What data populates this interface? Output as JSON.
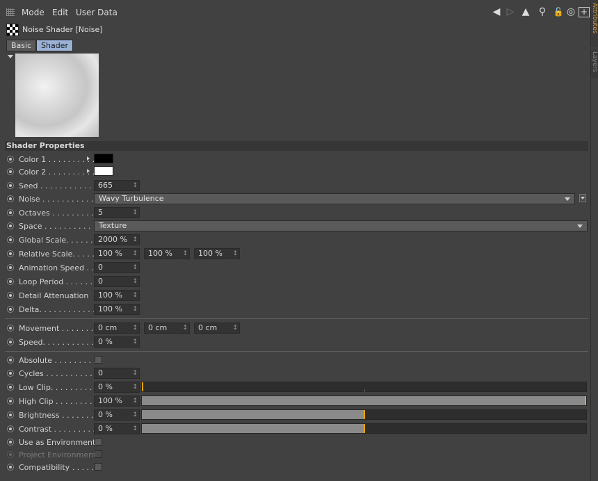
{
  "menu": {
    "grip_icon": "grip-icon",
    "items": [
      "Mode",
      "Edit",
      "User Data"
    ]
  },
  "toolbar": {
    "icons": [
      "back-arrow-icon",
      "forward-arrow-icon",
      "up-arrow-icon",
      "search-icon",
      "lock-icon",
      "target-icon",
      "new-panel-icon"
    ]
  },
  "side_tabs": [
    "Attributes",
    "Layers"
  ],
  "header": {
    "title": "Noise Shader [Noise]",
    "tabs": [
      "Basic",
      "Shader"
    ],
    "active_tab": "Shader"
  },
  "section": {
    "title": "Shader Properties"
  },
  "colors": {
    "color1": "#000000",
    "color2": "#ffffff",
    "accent": "#f0a400"
  },
  "fields": {
    "color1": {
      "label": "Color 1 . . . . . . . . . ."
    },
    "color2": {
      "label": "Color 2 . . . . . . . . . ."
    },
    "seed": {
      "label": "Seed . . . . . . . . . . . . . .",
      "value": "665"
    },
    "noise": {
      "label": "Noise . . . . . . . . . . . . .",
      "value": "Wavy Turbulence"
    },
    "octaves": {
      "label": "Octaves . . . . . . . . . . .",
      "value": "5"
    },
    "space": {
      "label": "Space . . . . . . . . . . . . .",
      "value": "Texture"
    },
    "global_scale": {
      "label": "Global Scale. . . . . . .",
      "value": "2000 %"
    },
    "relative_scale": {
      "label": "Relative Scale. . . . . .",
      "values": [
        "100 %",
        "100 %",
        "100 %"
      ]
    },
    "animation_speed": {
      "label": "Animation Speed . .",
      "value": "0"
    },
    "loop_period": {
      "label": "Loop Period . . . . . . .",
      "value": "0"
    },
    "detail_attenuation": {
      "label": "Detail Attenuation",
      "value": "100 %"
    },
    "delta": {
      "label": "Delta. . . . . . . . . . . . . .",
      "value": "100 %"
    },
    "movement": {
      "label": "Movement . . . . . . . . .",
      "values": [
        "0 cm",
        "0 cm",
        "0 cm"
      ]
    },
    "speed": {
      "label": "Speed. . . . . . . . . . . . .",
      "value": "0 %"
    },
    "absolute": {
      "label": "Absolute . . . . . . . . . ."
    },
    "cycles": {
      "label": "Cycles . . . . . . . . . . . .",
      "value": "0"
    },
    "low_clip": {
      "label": "Low Clip. . . . . . . . . . .",
      "value": "0 %",
      "level": 0.0
    },
    "high_clip": {
      "label": "High Clip . . . . . . . . . .",
      "value": "100 %",
      "level": 1.0
    },
    "brightness": {
      "label": "Brightness . . . . . . . . .",
      "value": "0 %",
      "level": 0.5
    },
    "contrast": {
      "label": "Contrast . . . . . . . . . . .",
      "value": "0 %",
      "level": 0.5
    },
    "use_as_environment": {
      "label": "Use as Environment"
    },
    "project_environment": {
      "label": "Project Environment"
    },
    "compatibility": {
      "label": "Compatibility . . . . . ."
    }
  }
}
